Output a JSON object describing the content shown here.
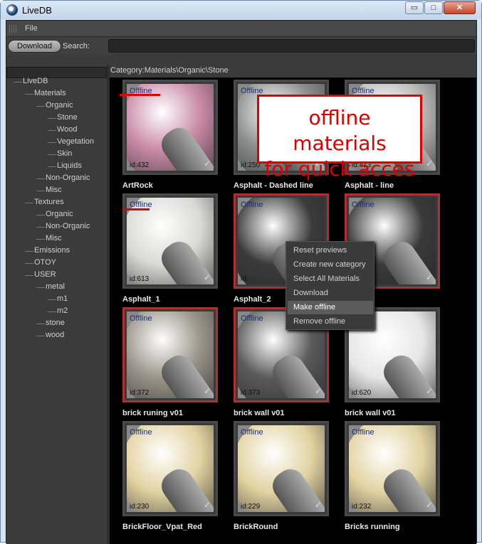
{
  "window": {
    "title": "LiveDB",
    "min": "▭",
    "max": "□",
    "close": "✕"
  },
  "menubar": {
    "file": "File"
  },
  "toolbar": {
    "download": "Download",
    "search_label": "Search:",
    "search_value": ""
  },
  "breadcrumb": "Category:Materials\\Organic\\Stone",
  "tree": [
    {
      "label": "LiveDB",
      "depth": 0
    },
    {
      "label": "Materials",
      "depth": 1
    },
    {
      "label": "Organic",
      "depth": 2
    },
    {
      "label": "Stone",
      "depth": 3
    },
    {
      "label": "Wood",
      "depth": 3
    },
    {
      "label": "Vegetation",
      "depth": 3
    },
    {
      "label": "Skin",
      "depth": 3
    },
    {
      "label": "Liquids",
      "depth": 3
    },
    {
      "label": "Non-Organic",
      "depth": 2
    },
    {
      "label": "Misc",
      "depth": 2
    },
    {
      "label": "Textures",
      "depth": 1
    },
    {
      "label": "Organic",
      "depth": 2
    },
    {
      "label": "Non-Organic",
      "depth": 2
    },
    {
      "label": "Misc",
      "depth": 2
    },
    {
      "label": "Emissions",
      "depth": 1
    },
    {
      "label": "OTOY",
      "depth": 1
    },
    {
      "label": "USER",
      "depth": 1
    },
    {
      "label": "metal",
      "depth": 2
    },
    {
      "label": "m1",
      "depth": 3
    },
    {
      "label": "m2",
      "depth": 3
    },
    {
      "label": "stone",
      "depth": 2
    },
    {
      "label": "wood",
      "depth": 2
    }
  ],
  "materials": [
    {
      "status": "Offline",
      "id": "id:432",
      "name": "ArtRock",
      "selected": false,
      "color": "#c98aa6"
    },
    {
      "status": "Offline",
      "id": "id:250",
      "name": "Asphalt - Dashed line",
      "selected": false,
      "color": "#8c8f8d"
    },
    {
      "status": "Offline",
      "id": "id:413",
      "name": "Asphalt - line",
      "selected": false,
      "color": "#b9b9b6"
    },
    {
      "status": "Offline",
      "id": "id:613",
      "name": "Asphalt_1",
      "selected": false,
      "color": "#d9d9d6"
    },
    {
      "status": "Offline",
      "id": "id:",
      "name": "Asphalt_2",
      "selected": true,
      "color": "#3b3b3b"
    },
    {
      "status": "Offline",
      "id": "",
      "name": "",
      "selected": true,
      "color": "#3a3a3a"
    },
    {
      "status": "Offline",
      "id": "id:372",
      "name": "brick runing v01",
      "selected": true,
      "color": "#9a948a"
    },
    {
      "status": "Offline",
      "id": "id:373",
      "name": "brick wall v01",
      "selected": true,
      "color": "#5a5a5a"
    },
    {
      "status": "Offline",
      "id": "id:620",
      "name": "brick wall v01",
      "selected": false,
      "color": "#e6e6e6"
    },
    {
      "status": "Offline",
      "id": "id:230",
      "name": "BrickFloor_Vpat_Red",
      "selected": false,
      "color": "#e2d3a2"
    },
    {
      "status": "Offline",
      "id": "id:229",
      "name": "BrickRound",
      "selected": false,
      "color": "#e2d3a2"
    },
    {
      "status": "Offline",
      "id": "id:232",
      "name": "Bricks running",
      "selected": false,
      "color": "#e2d3a2"
    }
  ],
  "callout": {
    "line1": "offline materials",
    "line2": "for quick acces"
  },
  "context_menu": [
    {
      "label": "Reset previews",
      "highlighted": false
    },
    {
      "label": "Create new category",
      "highlighted": false
    },
    {
      "label": "Select All Materials",
      "highlighted": false
    },
    {
      "label": "Download",
      "highlighted": false
    },
    {
      "label": "Make offline",
      "highlighted": true
    },
    {
      "label": "Remove offline",
      "highlighted": false
    }
  ]
}
